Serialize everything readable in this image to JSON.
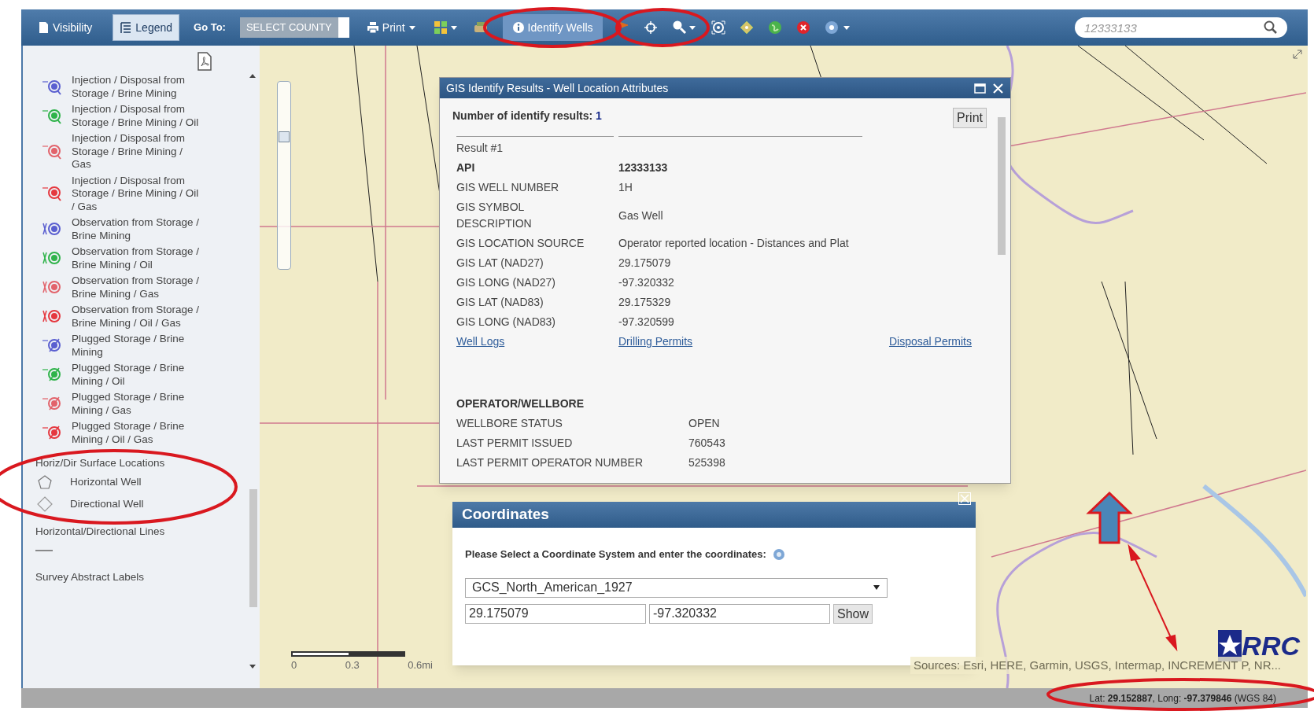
{
  "toolbar": {
    "tabs": [
      {
        "label": "Visibility",
        "selected": false
      },
      {
        "label": "Legend",
        "selected": true
      }
    ],
    "goto_label": "Go To:",
    "county_select": {
      "value": "SELECT COUNTY"
    },
    "print_button": {
      "label": "Print"
    },
    "identify_button": {
      "label": "Identify Wells",
      "active": true
    },
    "search": {
      "placeholder": "12333133"
    }
  },
  "zoom_slider": {
    "level": 0.72
  },
  "legend": {
    "items": [
      {
        "kind": "injection",
        "color": "#5a5fd0",
        "label": "Injection / Disposal from Storage / Brine Mining"
      },
      {
        "kind": "injection",
        "color": "#2fb34a",
        "label": "Injection / Disposal from Storage / Brine Mining / Oil"
      },
      {
        "kind": "injection",
        "color": "#e2636b",
        "label": "Injection / Disposal from Storage / Brine Mining / Gas"
      },
      {
        "kind": "injection",
        "color": "#e5383f",
        "label": "Injection / Disposal from Storage / Brine Mining / Oil / Gas"
      },
      {
        "kind": "observation",
        "color": "#5a5fd0",
        "label": "Observation from Storage / Brine Mining"
      },
      {
        "kind": "observation",
        "color": "#2fb34a",
        "label": "Observation from Storage / Brine Mining / Oil"
      },
      {
        "kind": "observation",
        "color": "#e2636b",
        "label": "Observation from Storage / Brine Mining / Gas"
      },
      {
        "kind": "observation",
        "color": "#e5383f",
        "label": "Observation from Storage / Brine Mining / Oil / Gas"
      },
      {
        "kind": "plugged",
        "color": "#5a5fd0",
        "label": "Plugged Storage / Brine Mining"
      },
      {
        "kind": "plugged",
        "color": "#2fb34a",
        "label": "Plugged Storage / Brine Mining / Oil"
      },
      {
        "kind": "plugged",
        "color": "#e2636b",
        "label": "Plugged Storage / Brine Mining / Gas"
      },
      {
        "kind": "plugged",
        "color": "#e5383f",
        "label": "Plugged Storage / Brine Mining / Oil / Gas"
      }
    ],
    "sections": [
      {
        "title": "Horiz/Dir Surface Locations",
        "items": [
          {
            "kind": "pentagon",
            "label": "Horizontal Well"
          },
          {
            "kind": "diamond",
            "label": "Directional Well"
          }
        ]
      },
      {
        "title": "Horizontal/Directional Lines",
        "items": [
          {
            "kind": "line"
          }
        ]
      },
      {
        "title": "Survey Abstract Labels"
      }
    ]
  },
  "identify_window": {
    "title": "GIS Identify Results - Well Location Attributes",
    "count_label": "Number of identify results:",
    "count": "1",
    "print_button": "Print",
    "result_label": "Result #1",
    "attributes": [
      {
        "name": "API",
        "value": "12333133",
        "bold": true
      },
      {
        "name": "GIS WELL NUMBER",
        "value": "1H",
        "bold": false
      },
      {
        "name": "GIS SYMBOL DESCRIPTION",
        "value": "Gas Well",
        "bold": false
      },
      {
        "name": "GIS LOCATION SOURCE",
        "value": "Operator reported location - Distances and Plat",
        "bold": false
      },
      {
        "name": "GIS LAT (NAD27)",
        "value": "29.175079",
        "bold": false
      },
      {
        "name": "GIS LONG (NAD27)",
        "value": "-97.320332",
        "bold": false
      },
      {
        "name": "GIS LAT (NAD83)",
        "value": "29.175329",
        "bold": false
      },
      {
        "name": "GIS LONG (NAD83)",
        "value": "-97.320599",
        "bold": false
      }
    ],
    "links": [
      "Well Logs",
      "Drilling Permits",
      "Disposal Permits"
    ],
    "section_title": "OPERATOR/WELLBORE",
    "section_rows": [
      {
        "name": "WELLBORE STATUS",
        "value": "OPEN"
      },
      {
        "name": "LAST PERMIT ISSUED",
        "value": "760543"
      },
      {
        "name": "LAST PERMIT OPERATOR NUMBER",
        "value": "525398"
      }
    ]
  },
  "coordinates_dialog": {
    "title": "Coordinates",
    "prompt": "Please Select a Coordinate System and enter the coordinates:",
    "system": "GCS_North_American_1927",
    "latitude": "29.175079",
    "longitude": "-97.320332",
    "show_button": "Show"
  },
  "scale_bar": {
    "labels": [
      "0",
      "0.3",
      "0.6mi"
    ]
  },
  "attribution": "Sources: Esri, HERE, Garmin, USGS, Intermap, INCREMENT P, NR...",
  "logo": "RRC",
  "status_bar": {
    "coordinates": "Lat: **29.152887**, Long: **-97.379846** (WGS 84)"
  }
}
